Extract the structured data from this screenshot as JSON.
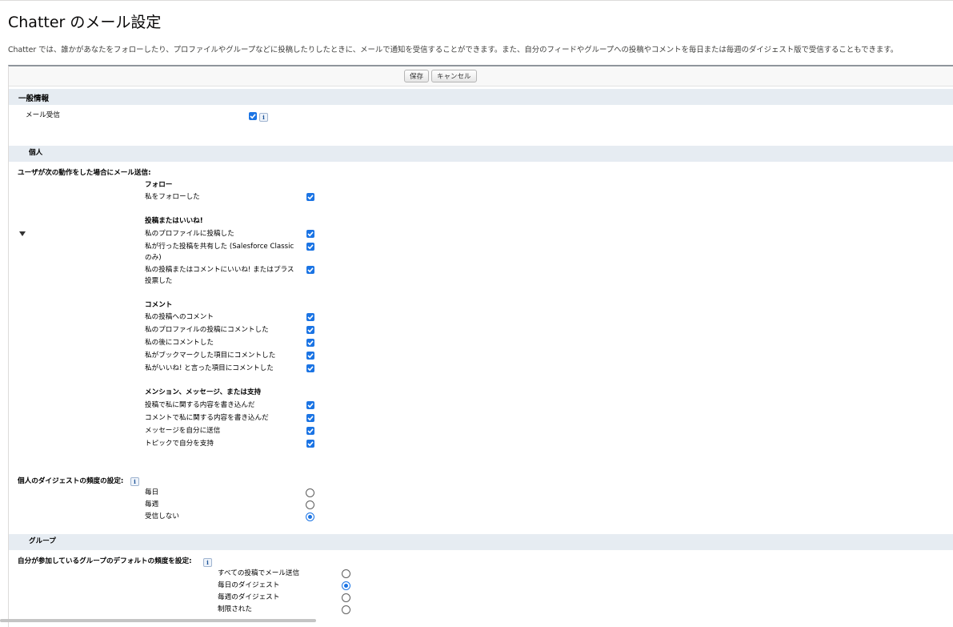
{
  "page": {
    "title": "Chatter のメール設定",
    "description": "Chatter では、誰かがあなたをフォローしたり、プロファイルやグループなどに投稿したりしたときに、メールで通知を受信することができます。また、自分のフィードやグループへの投稿やコメントを毎日または毎週のダイジェスト版で受信することもできます。"
  },
  "buttons": {
    "save": "保存",
    "cancel": "キャンセル"
  },
  "general": {
    "header": "一般情報",
    "email_receive_label": "メール受信",
    "email_receive_checked": true,
    "info_icon": "i"
  },
  "personal": {
    "header": "個人",
    "send_email_when": "ユーザが次の動作をした場合にメール送信:",
    "follow": {
      "title": "フォロー",
      "items": [
        {
          "label": "私をフォローした",
          "checked": true
        }
      ]
    },
    "posts": {
      "title": "投稿またはいいね!",
      "items": [
        {
          "label": "私のプロファイルに投稿した",
          "checked": true
        },
        {
          "label": "私が行った投稿を共有した (Salesforce Classic のみ)",
          "checked": true
        },
        {
          "label": "私の投稿またはコメントにいいね! またはプラス投票した",
          "checked": true
        }
      ]
    },
    "comments": {
      "title": "コメント",
      "items": [
        {
          "label": "私の投稿へのコメント",
          "checked": true
        },
        {
          "label": "私のプロファイルの投稿にコメントした",
          "checked": true
        },
        {
          "label": "私の後にコメントした",
          "checked": true
        },
        {
          "label": "私がブックマークした項目にコメントした",
          "checked": true
        },
        {
          "label": "私がいいね! と言った項目にコメントした",
          "checked": true
        }
      ]
    },
    "mentions": {
      "title": "メンション、メッセージ、または支持",
      "items": [
        {
          "label": "投稿で私に関する内容を書き込んだ",
          "checked": true
        },
        {
          "label": "コメントで私に関する内容を書き込んだ",
          "checked": true
        },
        {
          "label": "メッセージを自分に送信",
          "checked": true
        },
        {
          "label": "トピックで自分を支持",
          "checked": true
        }
      ]
    },
    "digest": {
      "label": "個人のダイジェストの頻度の設定:",
      "options": [
        "毎日",
        "毎週",
        "受信しない"
      ],
      "selected": "受信しない"
    }
  },
  "groups": {
    "header": "グループ",
    "default_frequency_label": "自分が参加しているグループのデフォルトの頻度を設定:",
    "options": [
      "すべての投稿でメール送信",
      "毎日のダイジェスト",
      "毎週のダイジェスト",
      "制限された"
    ],
    "selected": "毎日のダイジェスト"
  },
  "colors": {
    "accent": "#1b74e4",
    "section_bg": "#e6ecf2"
  }
}
